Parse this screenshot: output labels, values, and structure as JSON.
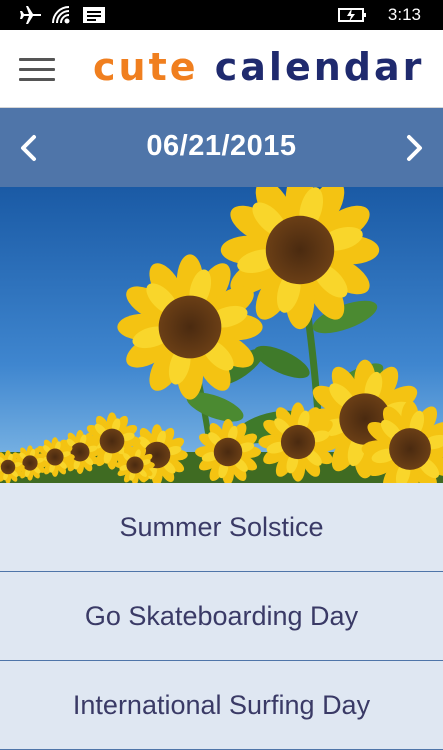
{
  "status": {
    "time": "3:13"
  },
  "app": {
    "logo_part1": "cute",
    "logo_part2": "calendar"
  },
  "date": {
    "current": "06/21/2015"
  },
  "events": [
    {
      "title": "Summer Solstice"
    },
    {
      "title": "Go Skateboarding Day"
    },
    {
      "title": "International Surfing Day"
    }
  ],
  "colors": {
    "date_bar": "#4f75a9",
    "logo_orange": "#f07f1f",
    "logo_navy": "#1f2a6e",
    "event_bg": "#dfe7f2"
  },
  "icons": [
    "airplane-icon",
    "wifi-icon",
    "message-icon",
    "battery-charging-icon",
    "menu-icon",
    "chevron-left-icon",
    "chevron-right-icon"
  ]
}
